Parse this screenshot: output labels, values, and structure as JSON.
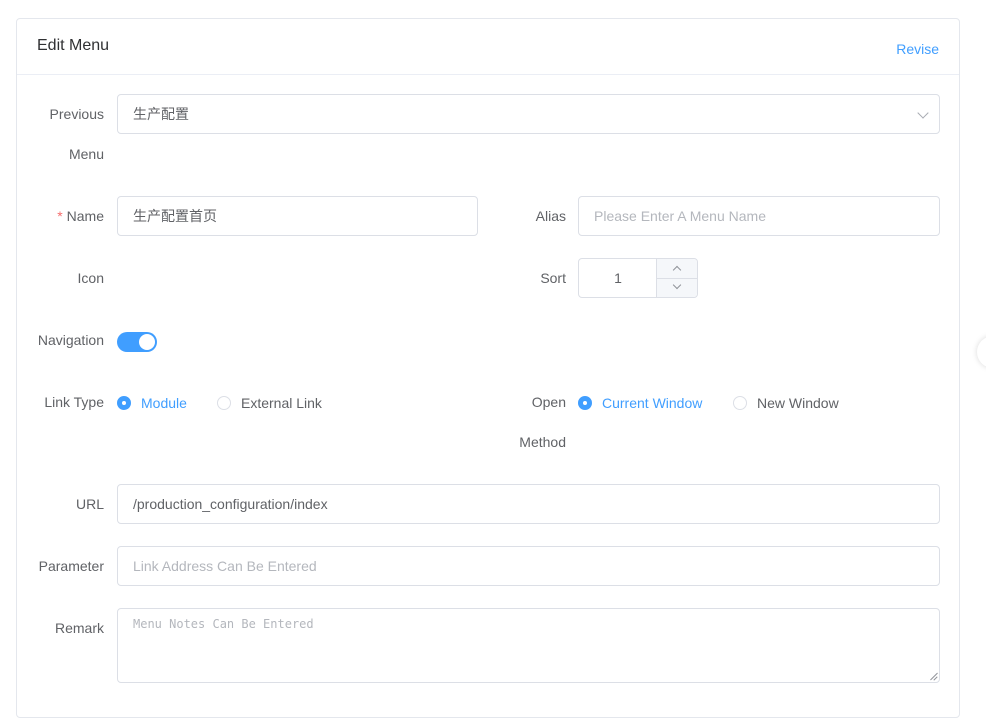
{
  "header": {
    "title": "Edit Menu",
    "revise_label": "Revise"
  },
  "form": {
    "previous_menu": {
      "label_line1": "Previous",
      "label_line2": "Menu",
      "value": "生产配置",
      "icon": "chevron-down-icon"
    },
    "name": {
      "required_mark": "*",
      "label": "Name",
      "value": "生产配置首页"
    },
    "alias": {
      "label": "Alias",
      "placeholder": "Please Enter A Menu Name"
    },
    "icon": {
      "label": "Icon"
    },
    "sort": {
      "label": "Sort",
      "value": "1"
    },
    "navigation": {
      "label": "Navigation",
      "enabled": true
    },
    "link_type": {
      "label": "Link Type",
      "options": [
        "Module",
        "External Link"
      ],
      "selected": "Module"
    },
    "open_method": {
      "label_line1": "Open",
      "label_line2": "Method",
      "options": [
        "Current Window",
        "New Window"
      ],
      "selected": "Current Window"
    },
    "url": {
      "label": "URL",
      "value": "/production_configuration/index"
    },
    "parameter": {
      "label": "Parameter",
      "placeholder": "Link Address Can Be Entered"
    },
    "remark": {
      "label": "Remark",
      "placeholder": "Menu Notes Can Be Entered"
    }
  },
  "colors": {
    "accent": "#409eff",
    "required": "#f56c6c",
    "border": "#dcdfe6"
  }
}
